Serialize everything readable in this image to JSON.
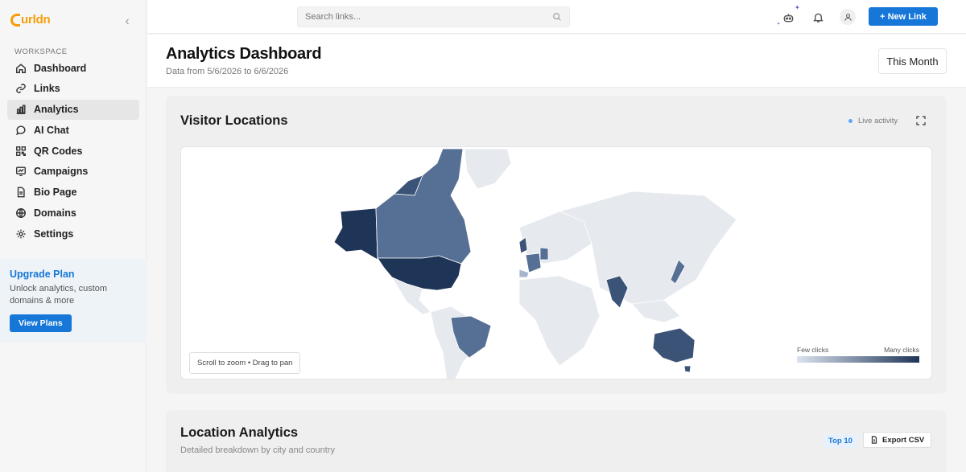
{
  "brand": {
    "name": "urldn",
    "color": "#f59e0b"
  },
  "sidebar": {
    "workspace_label": "WORKSPACE",
    "items": [
      {
        "label": "Dashboard",
        "icon": "home-icon"
      },
      {
        "label": "Links",
        "icon": "link-icon"
      },
      {
        "label": "Analytics",
        "icon": "bar-chart-icon",
        "active": true
      },
      {
        "label": "AI Chat",
        "icon": "chat-icon"
      },
      {
        "label": "QR Codes",
        "icon": "qr-code-icon"
      },
      {
        "label": "Campaigns",
        "icon": "campaign-icon"
      },
      {
        "label": "Bio Page",
        "icon": "document-icon"
      },
      {
        "label": "Domains",
        "icon": "globe-icon"
      },
      {
        "label": "Settings",
        "icon": "gear-icon"
      }
    ],
    "upgrade": {
      "title": "Upgrade Plan",
      "description": "Unlock analytics, custom domains & more",
      "button": "View Plans"
    }
  },
  "topbar": {
    "search_placeholder": "Search links...",
    "new_link_label": "+ New Link",
    "accent": "#1677d8"
  },
  "header": {
    "title": "Analytics Dashboard",
    "subtitle": "Data from 5/6/2026 to 6/6/2026",
    "range_label": "This Month"
  },
  "map_card": {
    "title": "Visitor Locations",
    "live_label": "Live activity",
    "hint": "Scroll to zoom • Drag to pan",
    "legend_low": "Few clicks",
    "legend_high": "Many clicks",
    "scale_colors": [
      "#dbe3ef",
      "#1f3557"
    ]
  },
  "location_card": {
    "title": "Location Analytics",
    "subtitle": "Detailed breakdown by city and country",
    "badge": "Top 10",
    "export_label": "Export CSV"
  }
}
